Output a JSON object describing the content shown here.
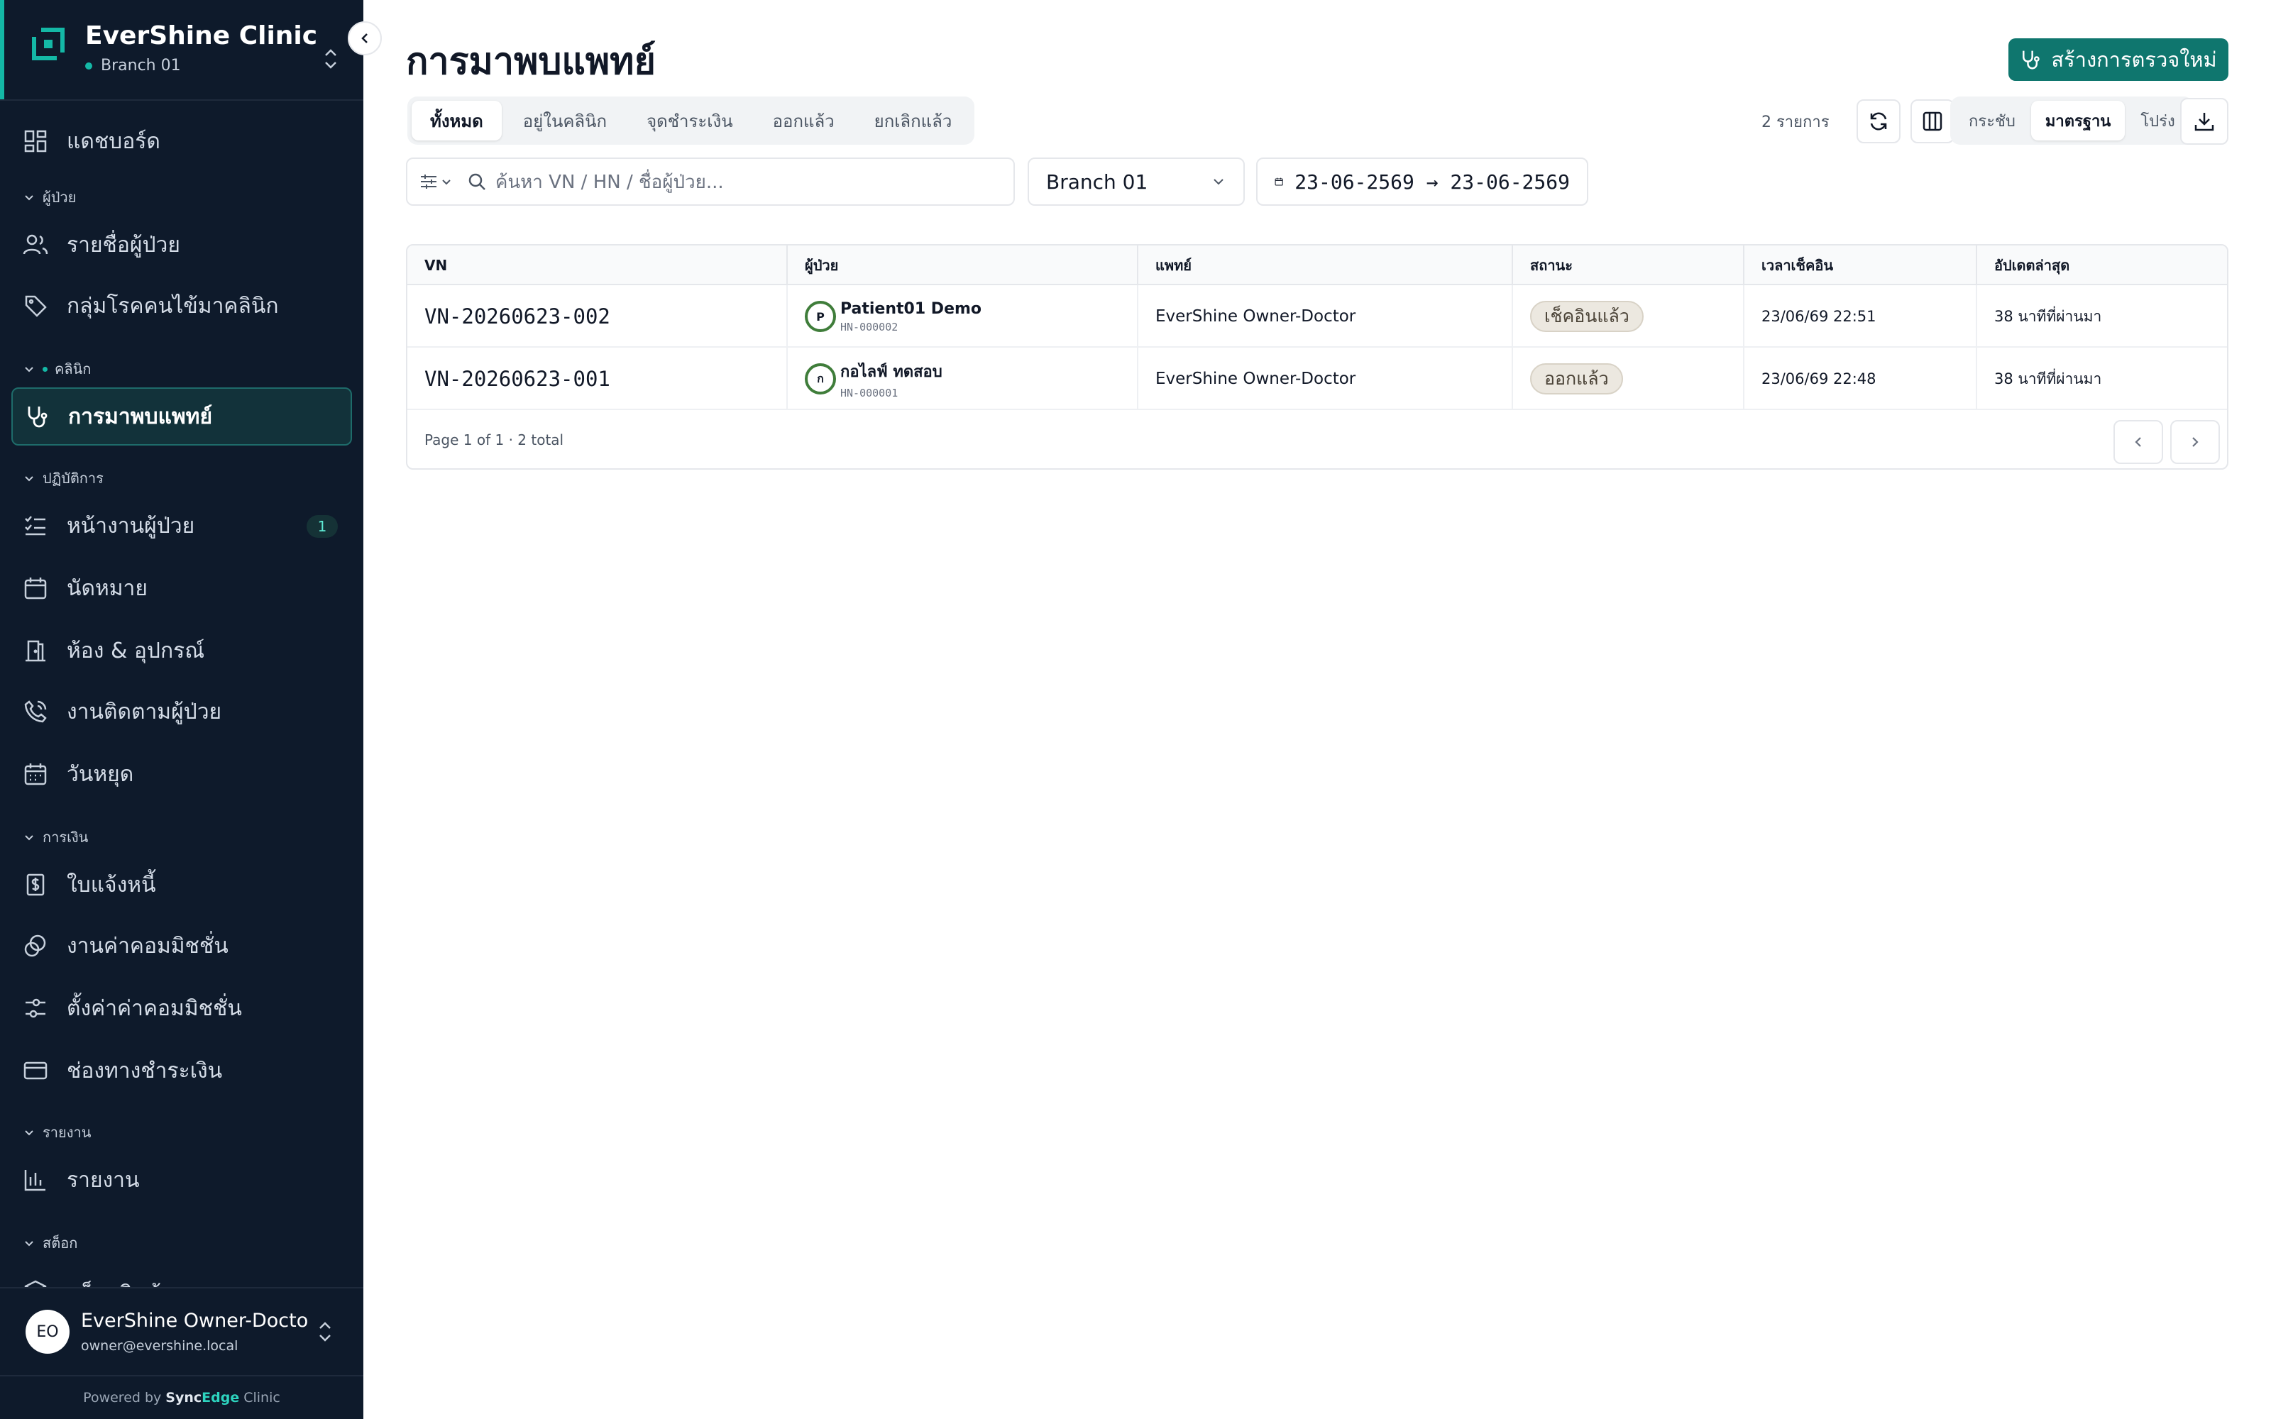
{
  "brand": {
    "name": "EverShine Clinic",
    "branch": "Branch 01"
  },
  "sidebar": {
    "items": {
      "dashboard": "แดชบอร์ด",
      "patient_list": "รายชื่อผู้ป่วย",
      "chronic_groups": "กลุ่มโรคคนไข้มาคลินิก",
      "visits": "การมาพบแพทย์",
      "patient_queue": "หน้างานผู้ป่วย",
      "patient_queue_badge": "1",
      "appointments": "นัดหมาย",
      "rooms": "ห้อง & อุปกรณ์",
      "followup": "งานติดตามผู้ป่วย",
      "holidays": "วันหยุด",
      "invoices": "ใบแจ้งหนี้",
      "commission_jobs": "งานค่าคอมมิชชั่น",
      "commission_settings": "ตั้งค่าค่าคอมมิชชั่น",
      "payment_channels": "ช่องทางชำระเงิน",
      "reports": "รายงาน",
      "stock_partial": "สต็อกสินค้า"
    },
    "sections": {
      "patients": "ผู้ป่วย",
      "clinic": "คลินิก",
      "operations": "ปฏิบัติการ",
      "finance": "การเงิน",
      "reports": "รายงาน",
      "stock": "สต็อก"
    }
  },
  "user": {
    "initials": "EO",
    "name": "EverShine Owner-Doctor",
    "email": "owner@evershine.local"
  },
  "footer": {
    "powered_prefix": "Powered by",
    "brand_sync": "Sync",
    "brand_edge": "Edge",
    "brand_suffix": "Clinic"
  },
  "page": {
    "title": "การมาพบแพทย์",
    "create_button": "สร้างการตรวจใหม่",
    "tabs": [
      "ทั้งหมด",
      "อยู่ในคลินิก",
      "จุดชำระเงิน",
      "ออกแล้ว",
      "ยกเลิกแล้ว"
    ],
    "count_text": "2 รายการ",
    "density": [
      "กระชับ",
      "มาตรฐาน",
      "โปร่ง"
    ],
    "search_placeholder": "ค้นหา VN / HN / ชื่อผู้ป่วย...",
    "branch_filter": "Branch 01",
    "date_range": "23-06-2569 → 23-06-2569"
  },
  "table": {
    "headers": [
      "VN",
      "ผู้ป่วย",
      "แพทย์",
      "สถานะ",
      "เวลาเช็คอิน",
      "อัปเดตล่าสุด"
    ],
    "rows": [
      {
        "vn": "VN-20260623-002",
        "initial": "P",
        "patient": "Patient01 Demo",
        "hn": "HN-000002",
        "doctor": "EverShine Owner-Doctor",
        "status": "เช็คอินแล้ว",
        "checkin": "23/06/69 22:51",
        "updated": "38 นาทีที่ผ่านมา"
      },
      {
        "vn": "VN-20260623-001",
        "initial": "ก",
        "patient": "กอไลฟ์ ทดสอบ",
        "hn": "HN-000001",
        "doctor": "EverShine Owner-Doctor",
        "status": "ออกแล้ว",
        "checkin": "23/06/69 22:48",
        "updated": "38 นาทีที่ผ่านมา"
      }
    ],
    "page_info": "Page 1 of 1 · 2 total"
  },
  "colors": {
    "sidebar_bg": "#0e1a2b",
    "accent": "#14b8a6",
    "primary_button": "#0f766e"
  }
}
